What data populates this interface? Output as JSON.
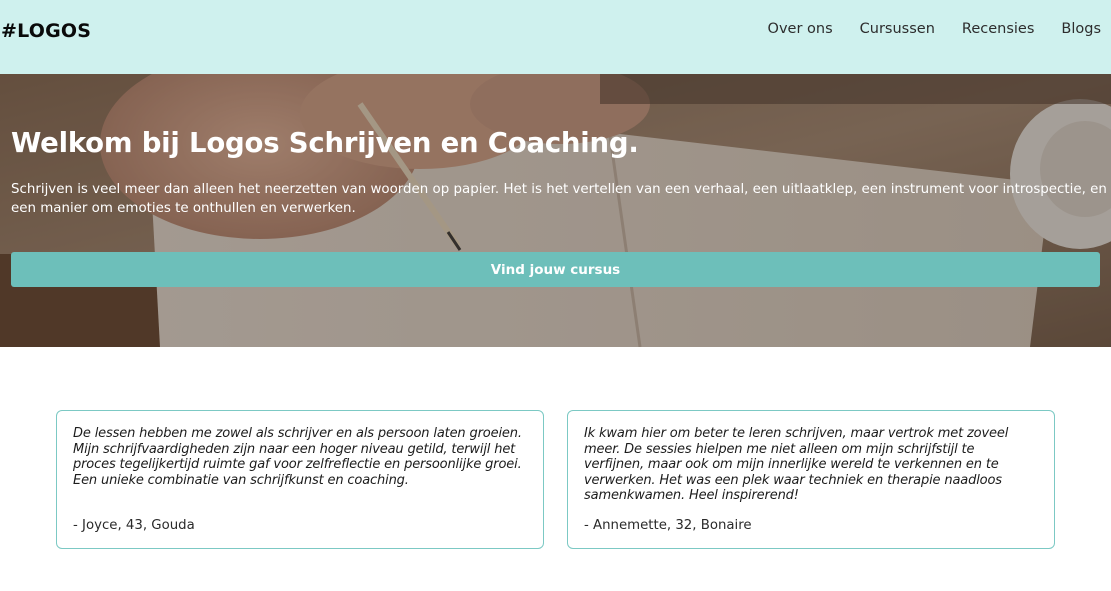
{
  "header": {
    "logo": "#LOGOS",
    "nav": [
      "Over ons",
      "Cursussen",
      "Recensies",
      "Blogs"
    ]
  },
  "hero": {
    "title": "Welkom bij Logos Schrijven en Coaching.",
    "text": "Schrijven is veel meer dan alleen het neerzetten van woorden op papier. Het is het vertellen van een verhaal, een uitlaatklep, een instrument voor introspectie, en een manier om emoties te onthullen en verwerken.",
    "button_label": "Vind jouw cursus"
  },
  "reviews": [
    {
      "quote": "De lessen hebben me zowel als schrijver en als persoon laten groeien. Mijn schrijfvaardigheden zijn naar een hoger niveau getild, terwijl het proces tegelijkertijd ruimte gaf voor zelfreflectie en persoonlijke groei. Een unieke combinatie van schrijfkunst en coaching.",
      "author": "- Joyce, 43, Gouda"
    },
    {
      "quote": "Ik kwam hier om beter te leren schrijven, maar vertrok met zoveel meer. De sessies hielpen me niet alleen om mijn schrijfstijl te verfijnen, maar ook om mijn innerlijke wereld te verkennen en te verwerken. Het was een plek waar techniek en therapie naadloos samenkwamen. Heel inspirerend!",
      "author": "- Annemette, 32, Bonaire"
    }
  ],
  "colors": {
    "header_bg": "#cff1ee",
    "accent": "#6dbfba",
    "card_border": "#7cc9c4"
  }
}
